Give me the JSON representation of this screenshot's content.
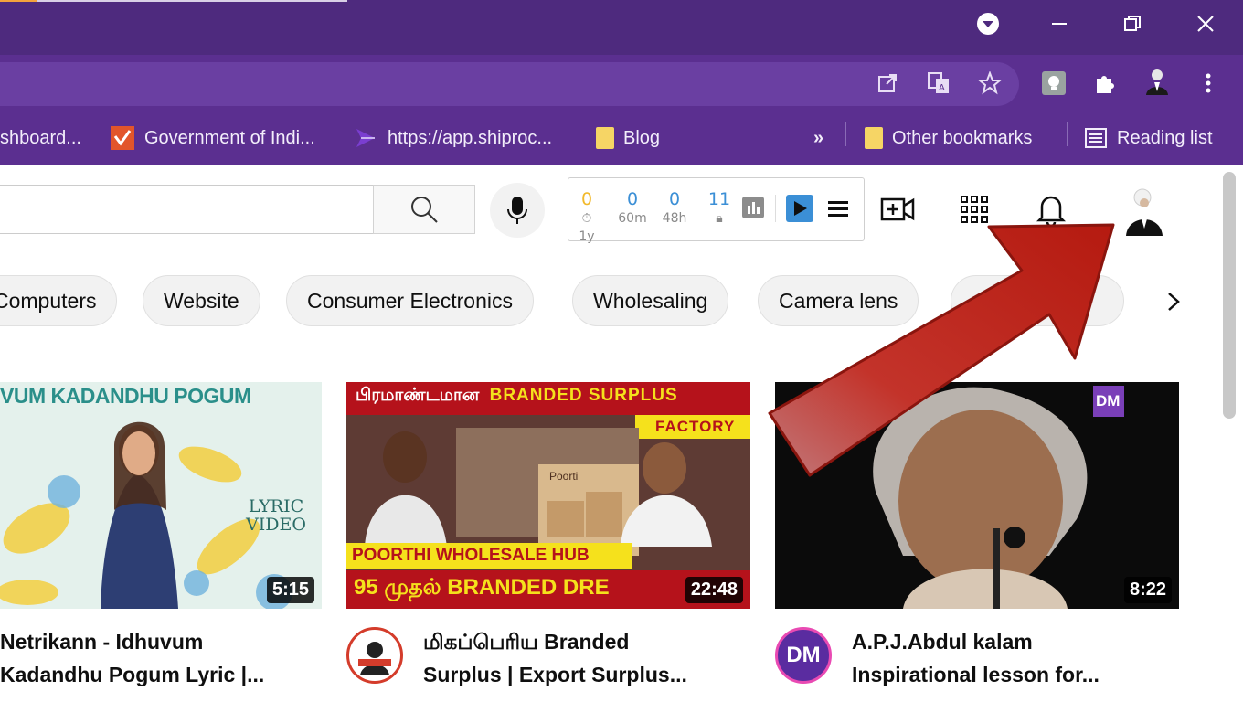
{
  "browser": {
    "bookmarks": [
      {
        "label": "shboard..."
      },
      {
        "label": "Government of Indi..."
      },
      {
        "label": "https://app.shiproc..."
      },
      {
        "label": "Blog"
      },
      {
        "label": "»"
      },
      {
        "label": "Other bookmarks"
      },
      {
        "label": "Reading list"
      }
    ]
  },
  "extension_stats": [
    {
      "value": "0",
      "label": "1y"
    },
    {
      "value": "0",
      "label": "60m"
    },
    {
      "value": "0",
      "label": "48h"
    },
    {
      "value": "11",
      "label": ""
    }
  ],
  "chips": [
    "Computers",
    "Website",
    "Consumer Electronics",
    "Wholesaling",
    "Camera lens"
  ],
  "videos": [
    {
      "thumb_title": "VUM KADANDHU POGUM",
      "thumb_sub": "LYRIC VIDEO",
      "duration": "5:15",
      "title_line1": "Netrikann - Idhuvum",
      "title_line2": "Kadandhu Pogum Lyric |..."
    },
    {
      "thumb_line1_tamil": "பிரமாண்டமான",
      "thumb_line1_en": "BRANDED SURPLUS",
      "thumb_factory": "FACTORY",
      "thumb_box": "Poorti",
      "thumb_hub": "POORTHI WHOLESALE HUB",
      "thumb_bottom": "95 முதல் BRANDED DRE",
      "duration": "22:48",
      "title_line1": "மிகப்பெரிய Branded",
      "title_line2": "Surplus | Export Surplus..."
    },
    {
      "thumb_logo": "DM",
      "duration": "8:22",
      "title_line1": "A.P.J.Abdul kalam",
      "title_line2": "Inspirational lesson for...",
      "avatar_text": "DM"
    }
  ],
  "colors": {
    "titlebar": "#4e2a7e",
    "toolbar": "#5b2f90",
    "arrow": "#c8281e"
  }
}
